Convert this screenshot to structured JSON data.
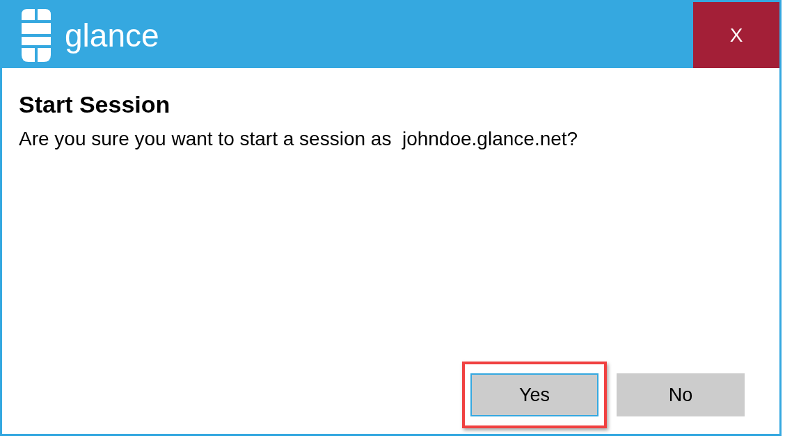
{
  "window": {
    "brand": "glance",
    "close": "X"
  },
  "dialog": {
    "title": "Start Session",
    "message": "Are you sure you want to start a session as  johndoe.glance.net?"
  },
  "buttons": [
    {
      "label": "Yes",
      "focused": true,
      "highlighted": true
    },
    {
      "label": "No",
      "focused": false,
      "highlighted": false
    }
  ]
}
